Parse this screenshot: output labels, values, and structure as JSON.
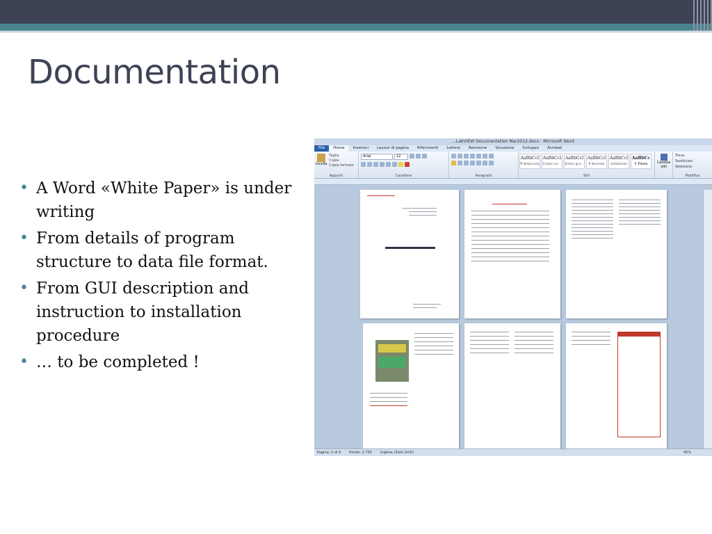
{
  "slide": {
    "title": "Documentation",
    "bullets": [
      "A Word «White Paper» is under writing",
      "From details of program structure to data file format.",
      "From GUI description and instruction to installation procedure",
      "… to be completed !"
    ]
  },
  "colors": {
    "topbar": "#3e4255",
    "accent": "#49858e",
    "title": "#3e4255"
  },
  "word": {
    "title": "...LabVIEW Documentation Mar2012.docx - Microsoft Word",
    "tabs": [
      "File",
      "Home",
      "Inserisci",
      "Layout di pagina",
      "Riferimenti",
      "Lettere",
      "Revisione",
      "Visualizza",
      "Sviluppo",
      "Acrobat"
    ],
    "font_name": "Arial",
    "font_size": "12",
    "clipboard_items": [
      "Taglia",
      "Copia",
      "Copia formato"
    ],
    "paste_label": "Incolla",
    "group_labels": [
      "Appunti",
      "Carattere",
      "Paragrafo",
      "Stili",
      "Modifica"
    ],
    "styles": [
      {
        "sample": "AaBbCcI",
        "name": "¶ Didascalia"
      },
      {
        "sample": "AaBbCcI",
        "name": "Enfasi cor..."
      },
      {
        "sample": "AaBbCcI",
        "name": "Enfasi gra..."
      },
      {
        "sample": "AaBbCcI",
        "name": "¶ Normale"
      },
      {
        "sample": "AaBbCcI",
        "name": "Sottotitolo"
      },
      {
        "sample": "AaBbCc",
        "name": "¶ Titolo"
      }
    ],
    "change_styles": "Cambia stili",
    "edit_items": [
      "Trova",
      "Sostituisci",
      "Seleziona"
    ],
    "status": {
      "page": "Pagina: 2 di 9",
      "words": "Parole: 2.793",
      "language": "Inglese (Stati Uniti)",
      "zoom": "40%"
    }
  }
}
